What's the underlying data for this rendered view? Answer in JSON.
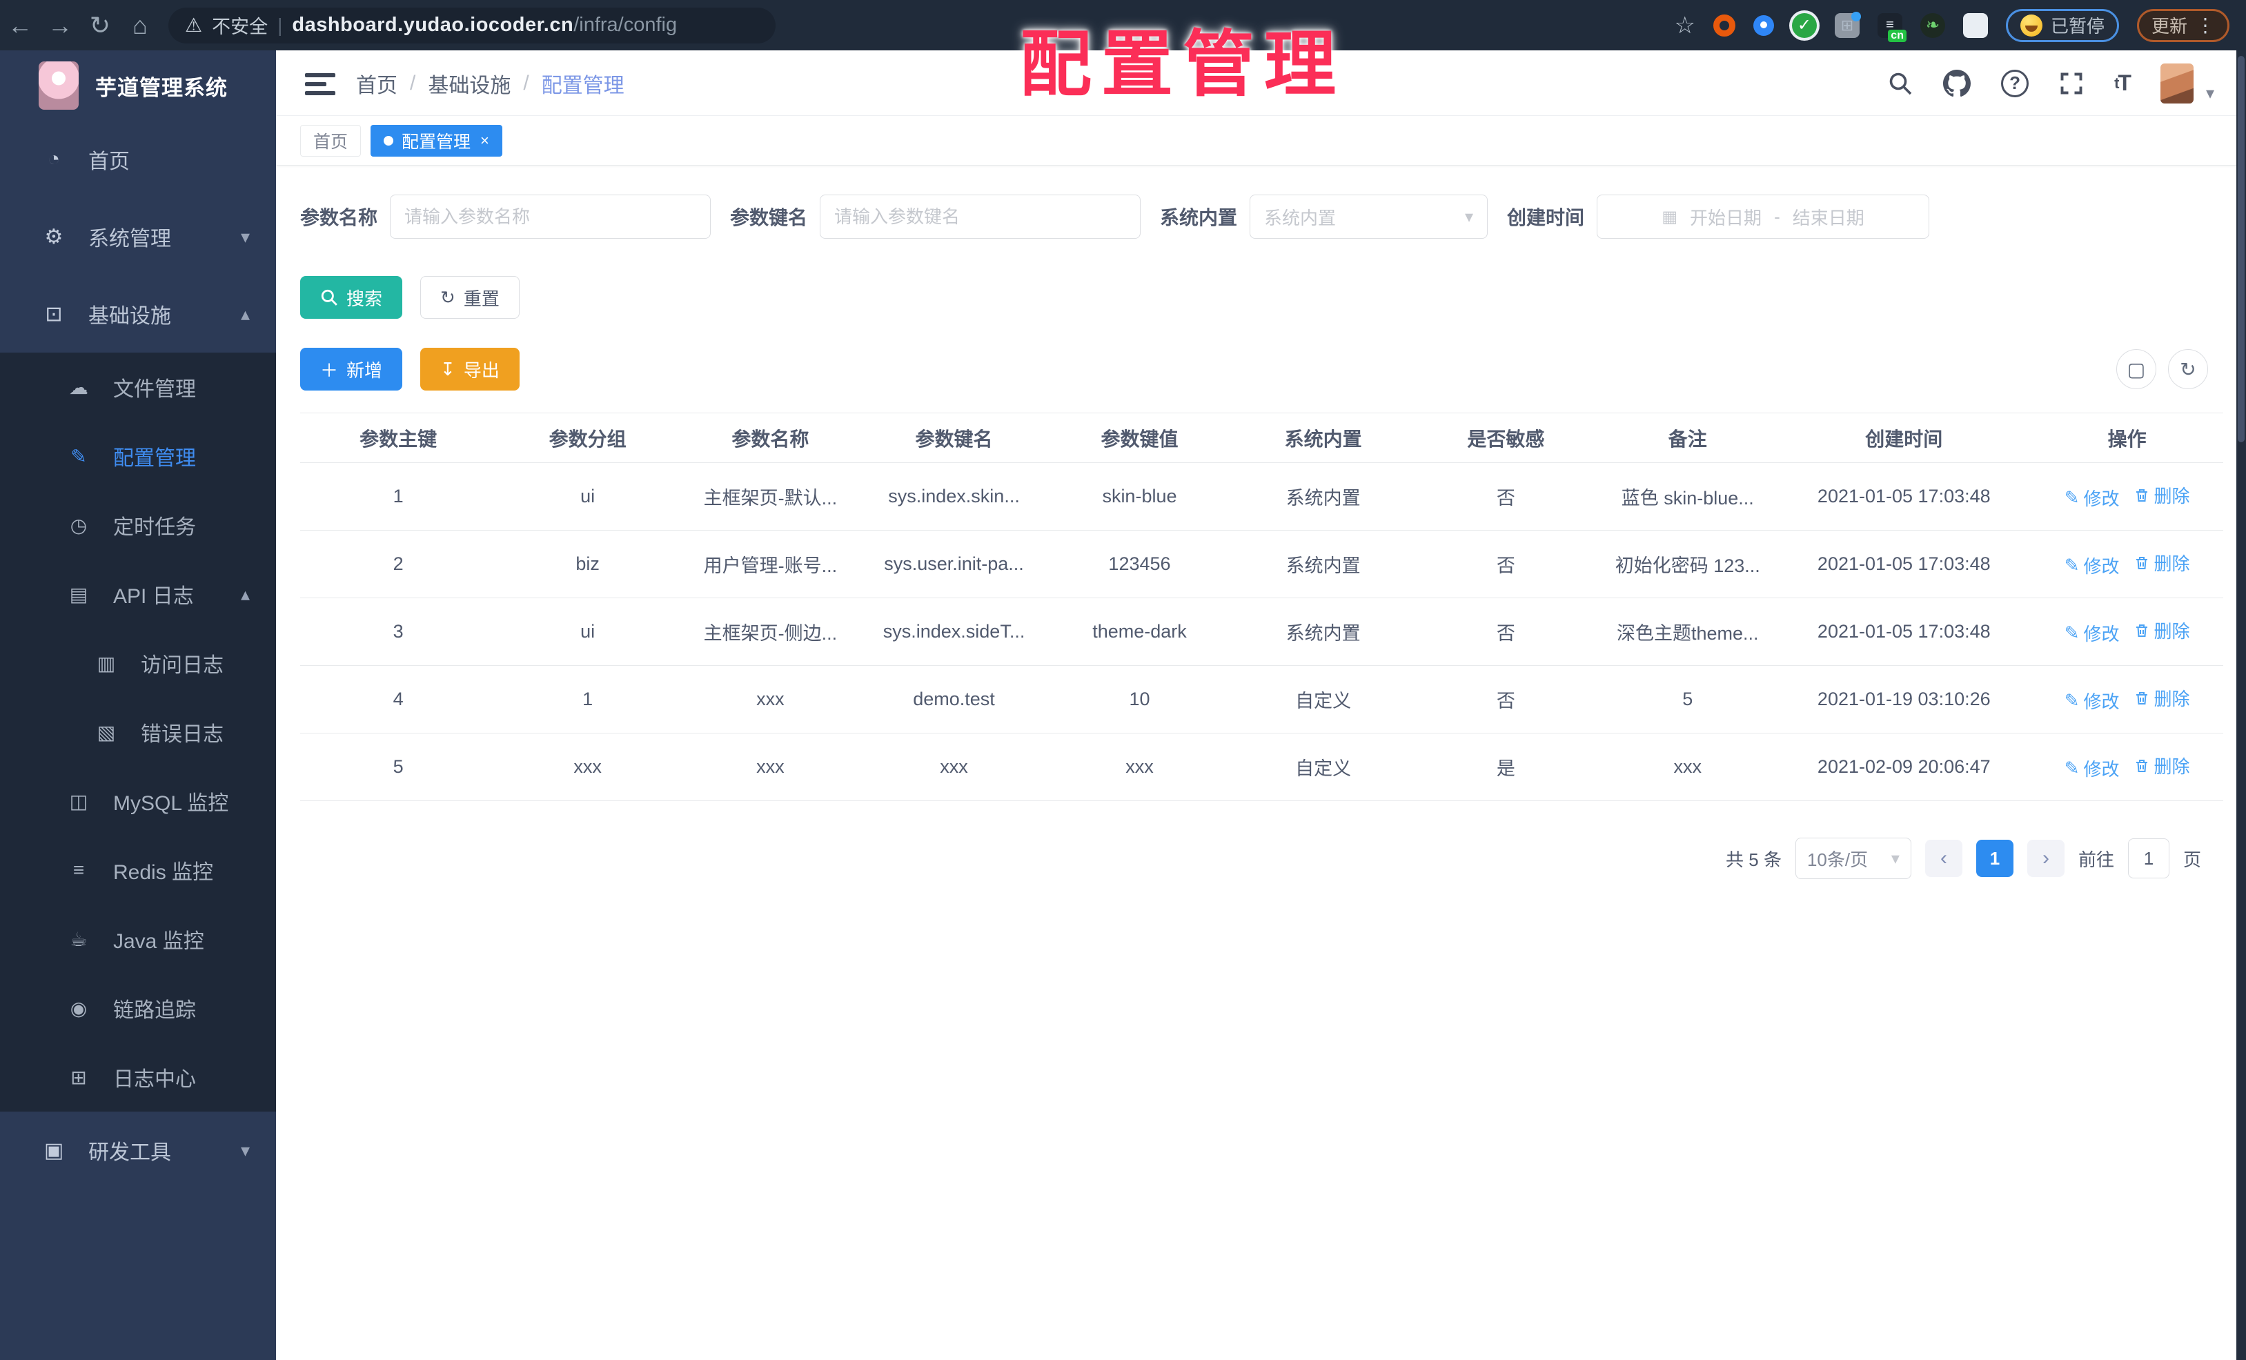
{
  "browser": {
    "back": "←",
    "forward": "→",
    "reload": "↻",
    "home": "⌂",
    "security_label": "不安全",
    "url_host": "dashboard.yudao.iocoder.cn",
    "url_path": "/infra/config",
    "paused_badge": "已暂停",
    "update_button": "更新",
    "cn_badge": "cn"
  },
  "overlay_title": "配置管理",
  "sidebar": {
    "logo_title": "芋道管理系统",
    "items": [
      {
        "label": "首页",
        "icon": "dashboard-icon",
        "indent": 1
      },
      {
        "label": "系统管理",
        "icon": "gear-icon",
        "indent": 1,
        "chevron": "down"
      },
      {
        "label": "基础设施",
        "icon": "infra-icon",
        "indent": 1,
        "chevron": "up"
      },
      {
        "label": "文件管理",
        "icon": "cloud-icon",
        "indent": 2
      },
      {
        "label": "配置管理",
        "icon": "edit-icon",
        "indent": 2,
        "active": true
      },
      {
        "label": "定时任务",
        "icon": "timer-icon",
        "indent": 2
      },
      {
        "label": "API 日志",
        "icon": "api-log-icon",
        "indent": 2,
        "chevron": "up"
      },
      {
        "label": "访问日志",
        "icon": "access-log-icon",
        "indent": 3
      },
      {
        "label": "错误日志",
        "icon": "error-log-icon",
        "indent": 3
      },
      {
        "label": "MySQL 监控",
        "icon": "mysql-icon",
        "indent": 2
      },
      {
        "label": "Redis 监控",
        "icon": "redis-icon",
        "indent": 2
      },
      {
        "label": "Java 监控",
        "icon": "java-icon",
        "indent": 2
      },
      {
        "label": "链路追踪",
        "icon": "eye-icon",
        "indent": 2
      },
      {
        "label": "日志中心",
        "icon": "log-center-icon",
        "indent": 2
      },
      {
        "label": "研发工具",
        "icon": "toolbox-icon",
        "indent": 1,
        "chevron": "down"
      }
    ]
  },
  "header": {
    "breadcrumb": [
      "首页",
      "基础设施",
      "配置管理"
    ],
    "font_size_icon": "tT"
  },
  "tags": [
    {
      "label": "首页",
      "active": false,
      "closable": false
    },
    {
      "label": "配置管理",
      "active": true,
      "closable": true
    }
  ],
  "filters": {
    "param_name": {
      "label": "参数名称",
      "placeholder": "请输入参数名称"
    },
    "param_key": {
      "label": "参数键名",
      "placeholder": "请输入参数键名"
    },
    "builtin": {
      "label": "系统内置",
      "placeholder": "系统内置"
    },
    "create_time": {
      "label": "创建时间",
      "start": "开始日期",
      "sep": "-",
      "end": "结束日期"
    }
  },
  "toolbar": {
    "search_label": "搜索",
    "reset_label": "重置",
    "add_label": "新增",
    "export_label": "导出"
  },
  "table": {
    "columns": [
      "参数主键",
      "参数分组",
      "参数名称",
      "参数键名",
      "参数键值",
      "系统内置",
      "是否敏感",
      "备注",
      "创建时间",
      "操作"
    ],
    "rows": [
      [
        "1",
        "ui",
        "主框架页-默认...",
        "sys.index.skin...",
        "skin-blue",
        "系统内置",
        "否",
        "蓝色 skin-blue...",
        "2021-01-05 17:03:48"
      ],
      [
        "2",
        "biz",
        "用户管理-账号...",
        "sys.user.init-pa...",
        "123456",
        "系统内置",
        "否",
        "初始化密码 123...",
        "2021-01-05 17:03:48"
      ],
      [
        "3",
        "ui",
        "主框架页-侧边...",
        "sys.index.sideT...",
        "theme-dark",
        "系统内置",
        "否",
        "深色主题theme...",
        "2021-01-05 17:03:48"
      ],
      [
        "4",
        "1",
        "xxx",
        "demo.test",
        "10",
        "自定义",
        "否",
        "5",
        "2021-01-19 03:10:26"
      ],
      [
        "5",
        "xxx",
        "xxx",
        "xxx",
        "xxx",
        "自定义",
        "是",
        "xxx",
        "2021-02-09 20:06:47"
      ]
    ],
    "actions": {
      "edit": "修改",
      "delete": "删除"
    }
  },
  "pagination": {
    "total": "共 5 条",
    "page_size": "10条/页",
    "prev": "‹",
    "current": "1",
    "next": "›",
    "goto_label": "前往",
    "goto_value": "1",
    "page_unit": "页"
  },
  "colors": {
    "primary": "#2d8cf0",
    "teal": "#23b7a3",
    "warning": "#f0a020",
    "overlay_red": "#fb2e57",
    "sidebar_bg": "#2c3a56",
    "submenu_bg": "#1e2838"
  }
}
